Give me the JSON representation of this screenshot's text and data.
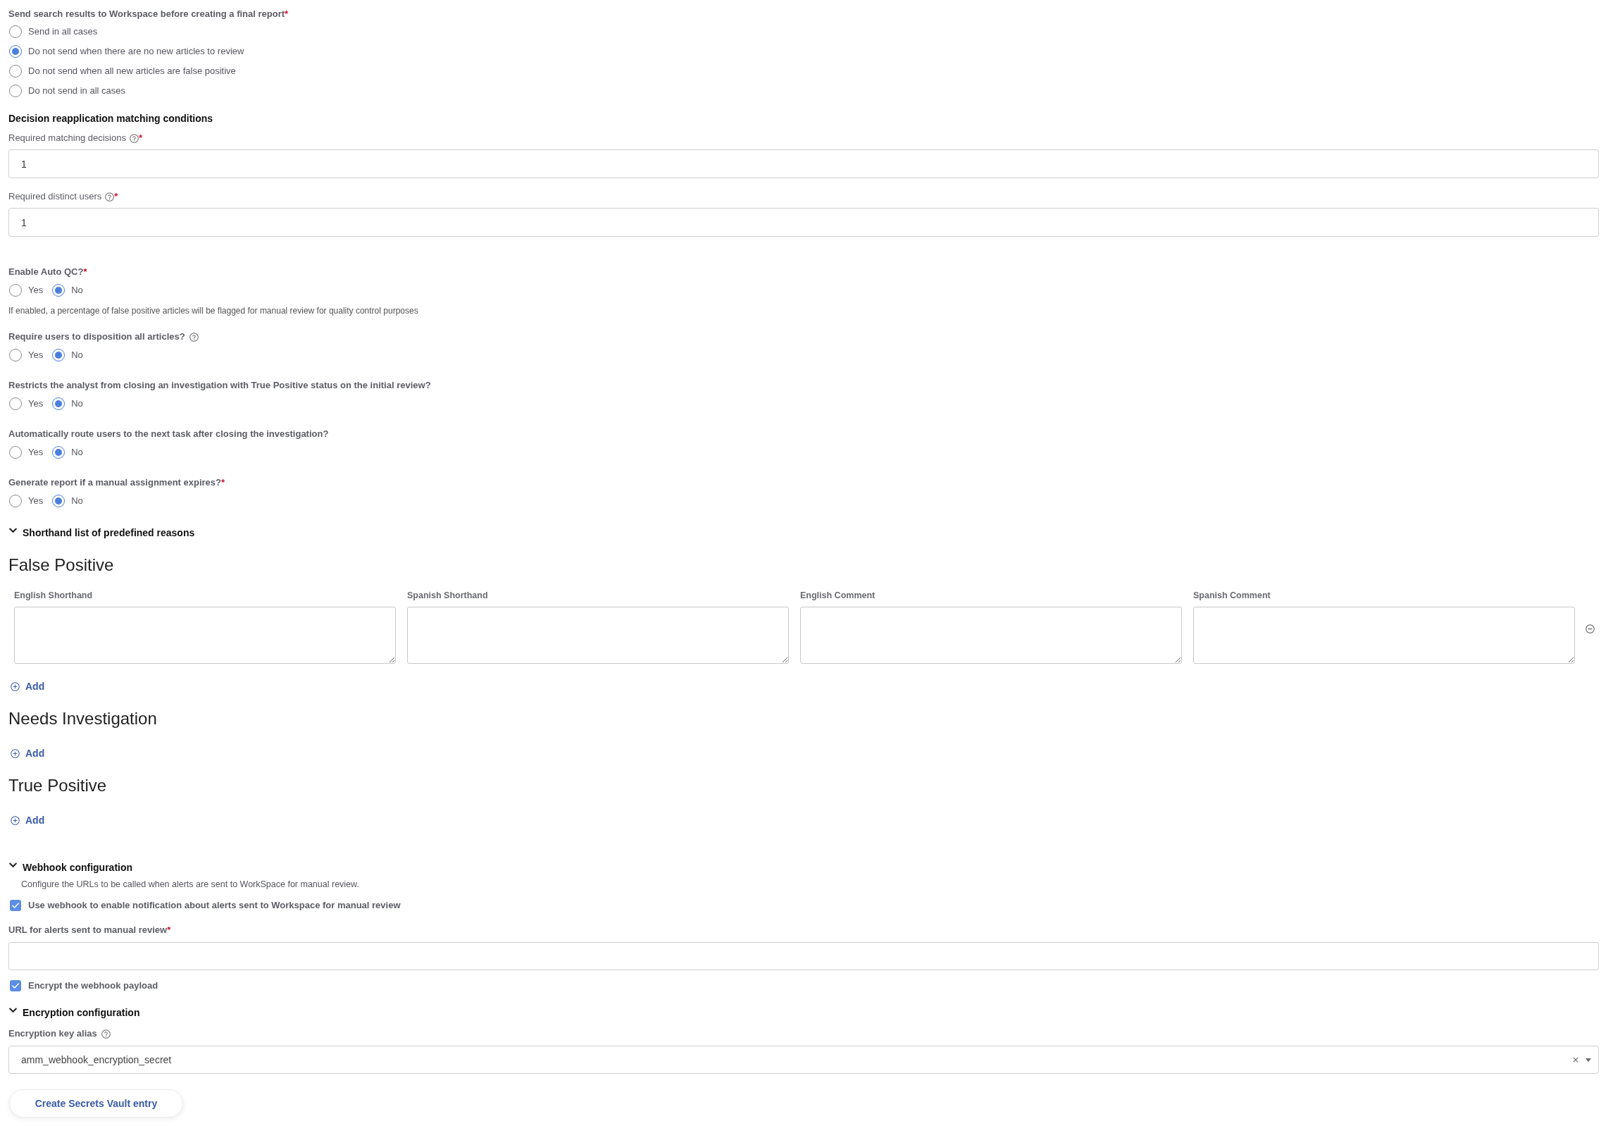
{
  "send_results": {
    "label": "Send search results to Workspace before creating a final report",
    "required_mark": "*",
    "options": [
      {
        "label": "Send in all cases",
        "selected": false
      },
      {
        "label": "Do not send when there are no new articles to review",
        "selected": true
      },
      {
        "label": "Do not send when all new articles are false positive",
        "selected": false
      },
      {
        "label": "Do not send in all cases",
        "selected": false
      }
    ]
  },
  "decision_reapplication": {
    "heading": "Decision reapplication matching conditions",
    "fields": [
      {
        "label": "Required matching decisions",
        "help": true,
        "required_mark": "*",
        "value": "1"
      },
      {
        "label": "Required distinct users",
        "help": true,
        "required_mark": "*",
        "value": "1"
      }
    ]
  },
  "questions": [
    {
      "label": "Enable Auto QC?",
      "required_mark": "*",
      "help": false,
      "options": [
        {
          "label": "Yes",
          "selected": false
        },
        {
          "label": "No",
          "selected": true
        }
      ],
      "note": "If enabled, a percentage of false positive articles will be flagged for manual review for quality control purposes"
    },
    {
      "label": "Require users to disposition all articles?",
      "help": true,
      "options": [
        {
          "label": "Yes",
          "selected": false
        },
        {
          "label": "No",
          "selected": true
        }
      ]
    },
    {
      "label": "Restricts the analyst from closing an investigation with True Positive status on the initial review?",
      "help": false,
      "options": [
        {
          "label": "Yes",
          "selected": false
        },
        {
          "label": "No",
          "selected": true
        }
      ]
    },
    {
      "label": "Automatically route users to the next task after closing the investigation?",
      "help": false,
      "options": [
        {
          "label": "Yes",
          "selected": false
        },
        {
          "label": "No",
          "selected": true
        }
      ]
    },
    {
      "label": "Generate report if a manual assignment expires?",
      "required_mark": "*",
      "help": false,
      "options": [
        {
          "label": "Yes",
          "selected": false
        },
        {
          "label": "No",
          "selected": true
        }
      ]
    }
  ],
  "predefined_reasons": {
    "title": "Shorthand list of predefined reasons",
    "expanded": true,
    "groups": [
      {
        "title": "False Positive",
        "columns": [
          "English Shorthand",
          "Spanish Shorthand",
          "English Comment",
          "Spanish Comment"
        ],
        "rows": [
          {
            "removable": true
          }
        ],
        "add_label": "Add"
      },
      {
        "title": "Needs Investigation",
        "add_label": "Add"
      },
      {
        "title": "True Positive",
        "add_label": "Add"
      }
    ]
  },
  "webhook": {
    "title": "Webhook configuration",
    "expanded": true,
    "description": "Configure the URLs to be called when alerts are sent to WorkSpace for manual review.",
    "use_webhook": {
      "label": "Use webhook to enable notification about alerts sent to Workspace for manual review",
      "checked": true
    },
    "url_field": {
      "label": "URL for alerts sent to manual review",
      "required_mark": "*"
    },
    "encrypt_payload": {
      "label": "Encrypt the webhook payload",
      "checked": true
    }
  },
  "encryption": {
    "title": "Encryption configuration",
    "expanded": true,
    "key_alias": {
      "label": "Encryption key alias",
      "help": true,
      "value": "amm_webhook_encryption_secret"
    },
    "button": "Create Secrets Vault entry"
  }
}
